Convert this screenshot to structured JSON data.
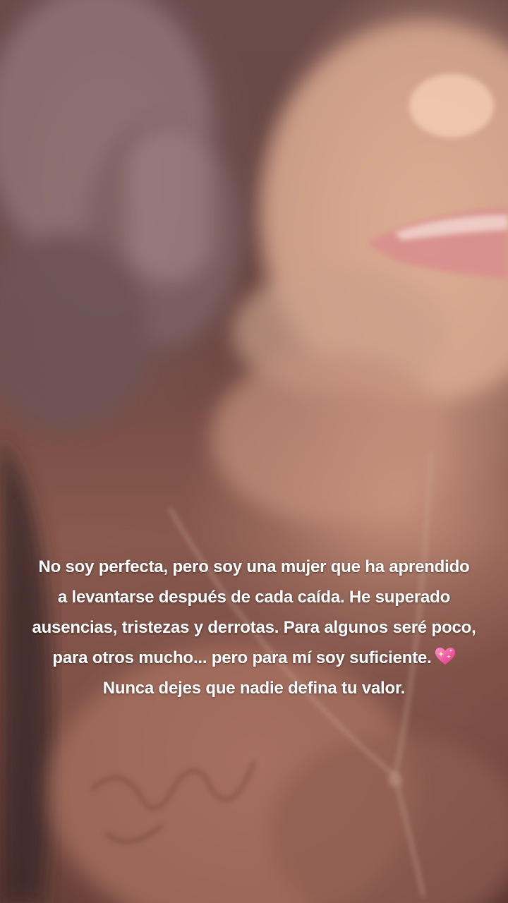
{
  "photo": {
    "icon": "blurred-portrait-photo"
  },
  "caption": {
    "lines": [
      "No soy perfecta, pero soy una mujer que ha aprendido",
      "a levantarse después de cada caída. He superado",
      "ausencias, tristezas y derrotas. Para algunos seré poco,",
      "para otros mucho... pero para mí soy suficiente.",
      "Nunca dejes que nadie defina tu valor."
    ],
    "emoji_icon": "sparkling-heart-icon",
    "text_color": "#ffffff"
  }
}
